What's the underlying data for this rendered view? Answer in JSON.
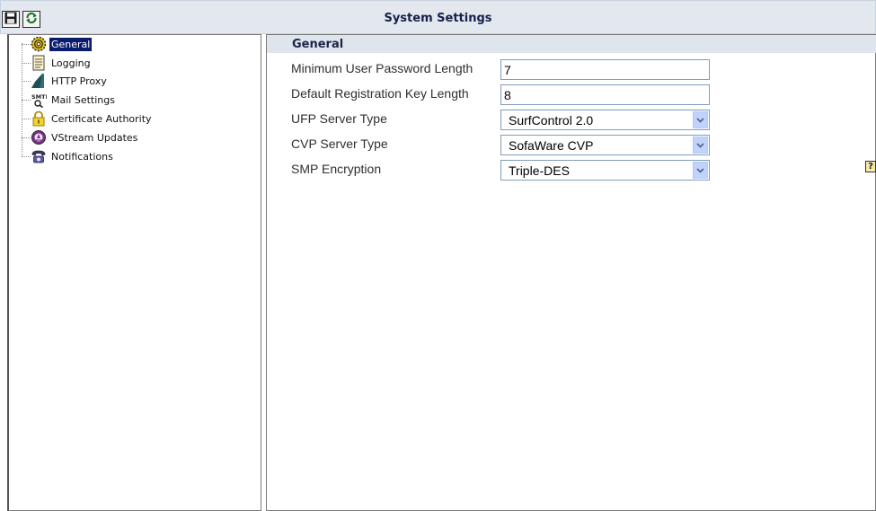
{
  "window": {
    "title": "System Settings"
  },
  "toolbar": [
    {
      "name": "save",
      "icon": "floppy-disk-icon"
    },
    {
      "name": "refresh",
      "icon": "refresh-icon"
    }
  ],
  "tree": {
    "items": [
      {
        "label": "General",
        "icon": "gear-icon",
        "selected": true
      },
      {
        "label": "Logging",
        "icon": "document-icon",
        "selected": false
      },
      {
        "label": "HTTP Proxy",
        "icon": "proxy-icon",
        "selected": false
      },
      {
        "label": "Mail Settings",
        "icon": "smtp-mail-icon",
        "selected": false
      },
      {
        "label": "Certificate Authority",
        "icon": "padlock-icon",
        "selected": false
      },
      {
        "label": "VStream Updates",
        "icon": "updates-icon",
        "selected": false
      },
      {
        "label": "Notifications",
        "icon": "telephone-icon",
        "selected": false
      }
    ]
  },
  "section": {
    "title": "General",
    "fields": [
      {
        "label": "Minimum User Password Length",
        "type": "text",
        "value": "7"
      },
      {
        "label": "Default Registration Key Length",
        "type": "text",
        "value": "8"
      },
      {
        "label": "UFP Server Type",
        "type": "select",
        "value": "SurfControl 2.0"
      },
      {
        "label": "CVP Server Type",
        "type": "select",
        "value": "SofaWare CVP"
      },
      {
        "label": "SMP Encryption",
        "type": "select",
        "value": "Triple-DES"
      }
    ]
  },
  "help": {
    "icon": "help-icon",
    "label": "?"
  },
  "colors": {
    "title_bar": "#e3e8ee",
    "section_header": "#dfe5ec",
    "selection": "#0a1c6e",
    "field_border": "#7f9db9",
    "dropdown_button": "#c1d3fb"
  }
}
